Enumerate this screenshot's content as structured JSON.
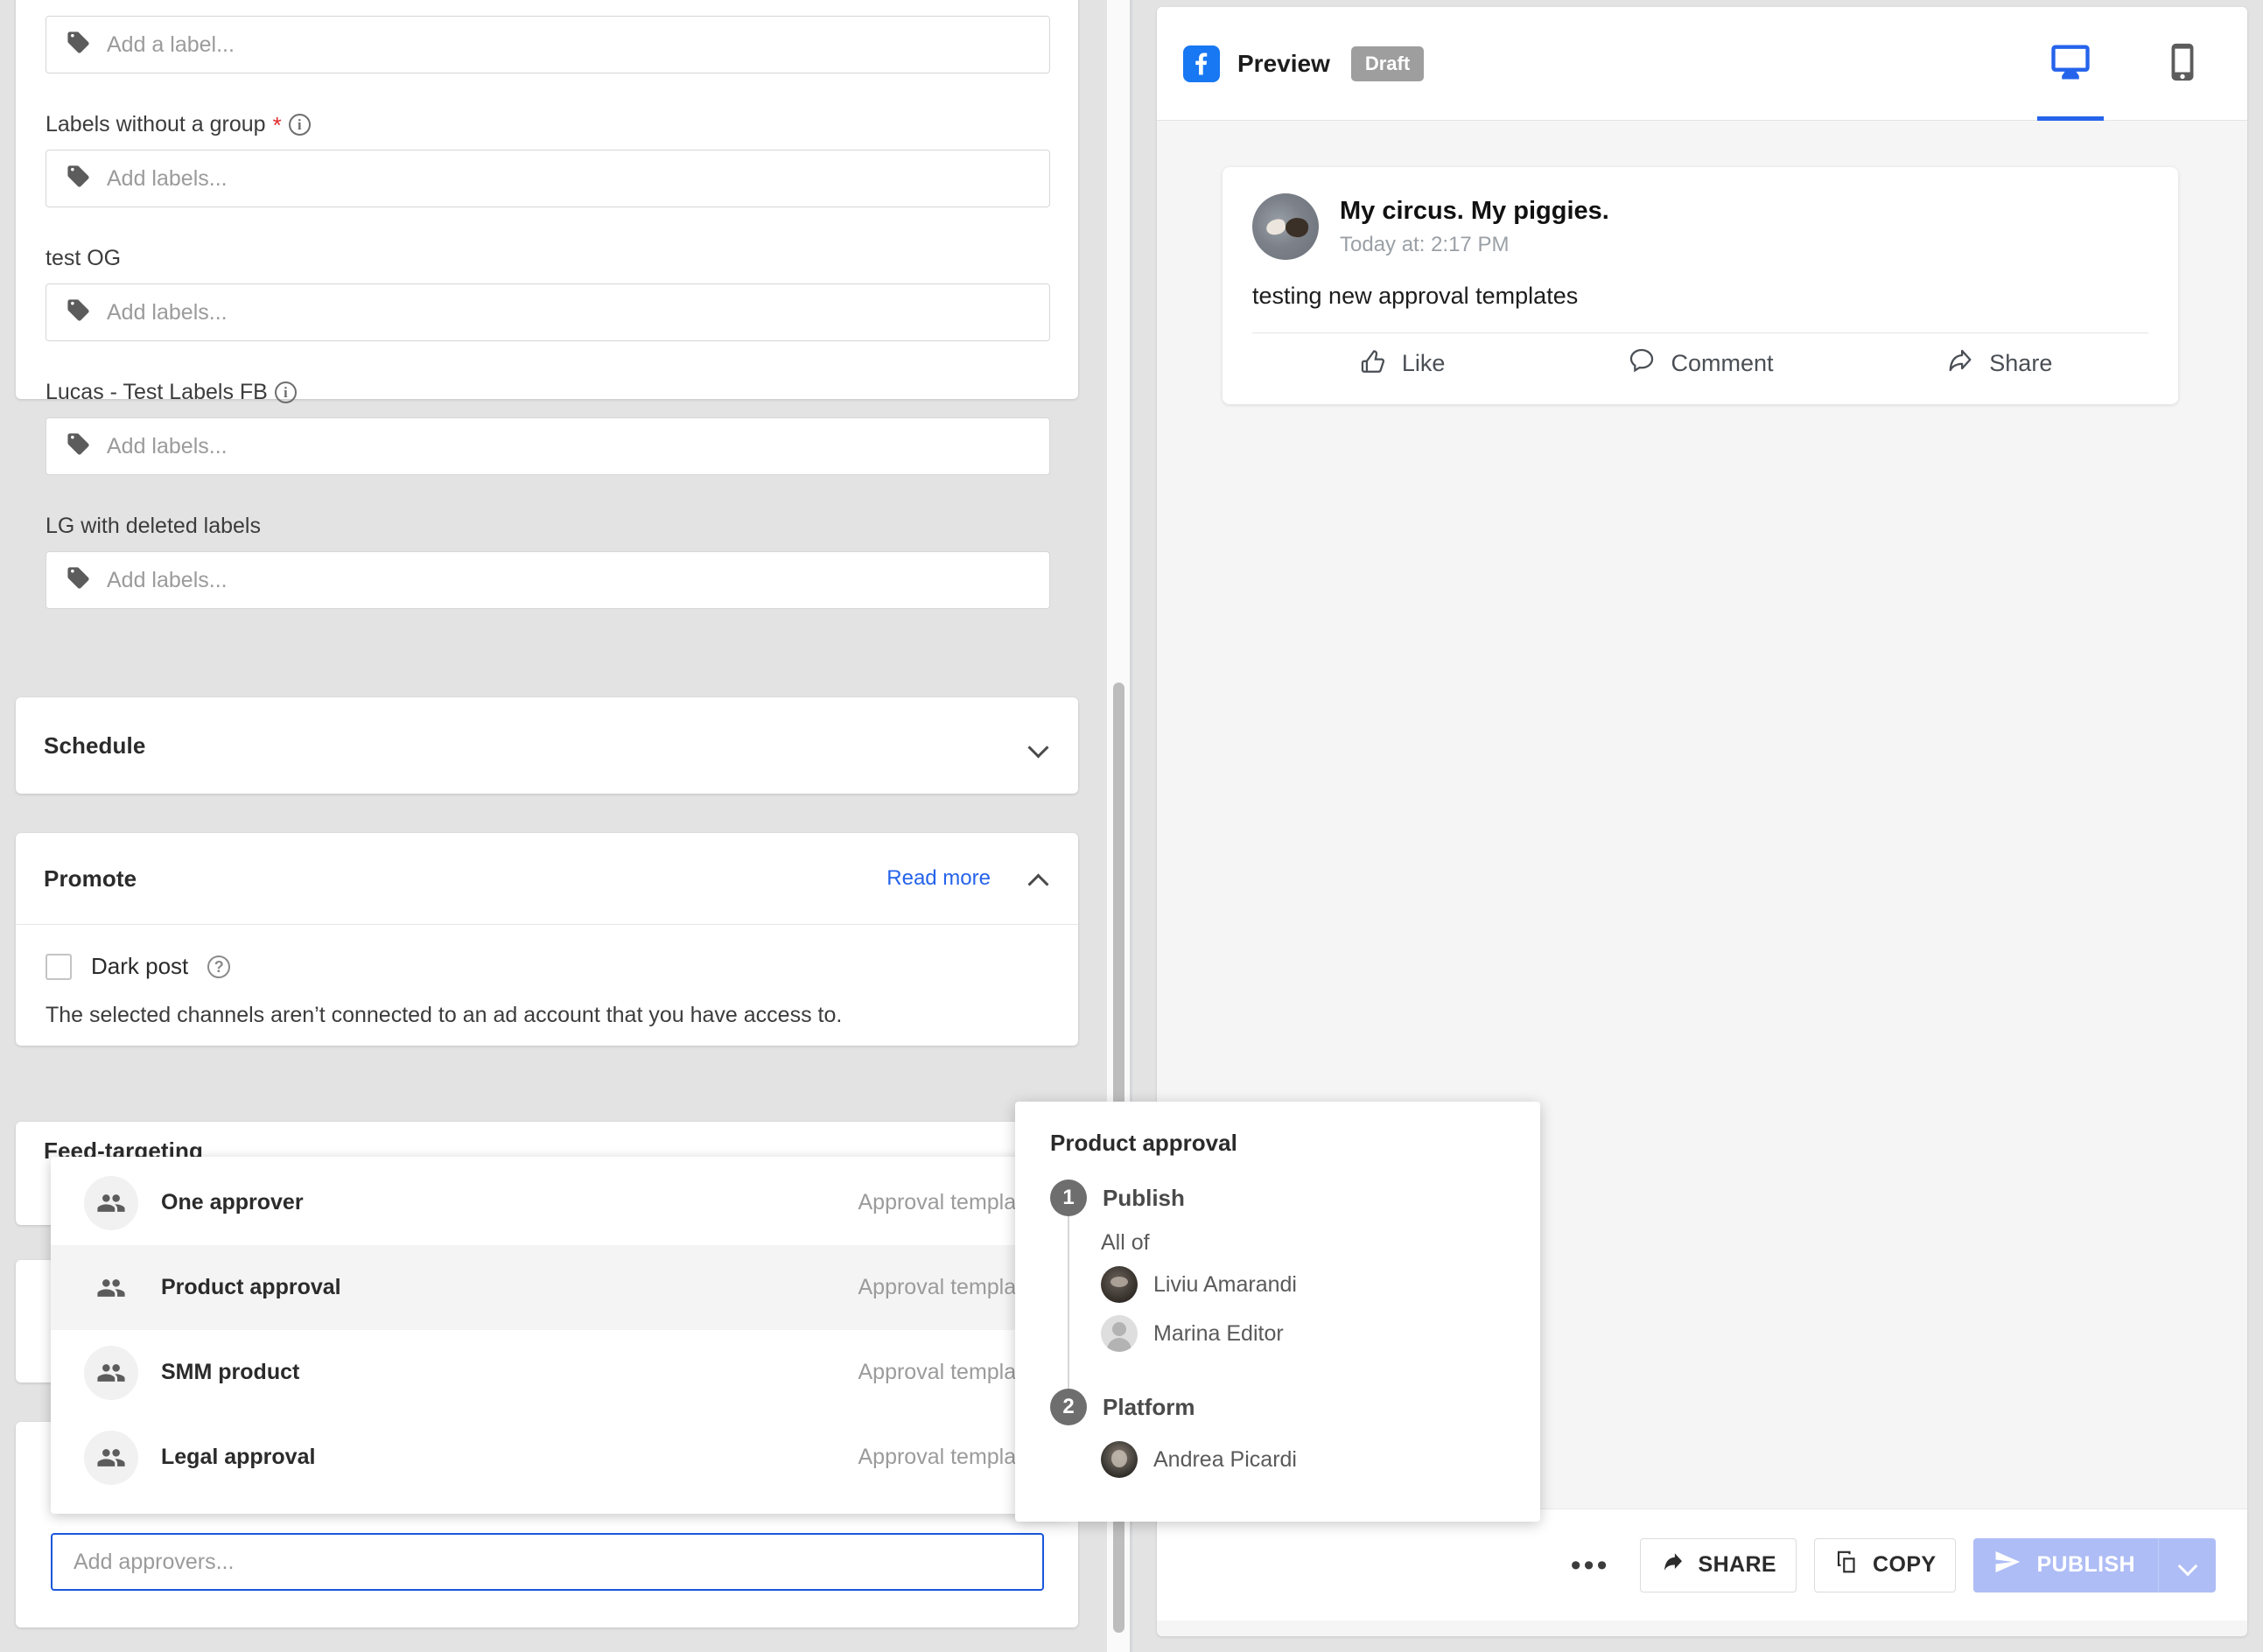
{
  "left_panel": {
    "labels_card": {
      "top_input_placeholder": "Add a label...",
      "groups": [
        {
          "title": "Labels without a group",
          "required": true,
          "has_info": true,
          "placeholder": "Add labels..."
        },
        {
          "title": "test OG",
          "required": false,
          "has_info": false,
          "placeholder": "Add labels..."
        },
        {
          "title": "Lucas - Test Labels FB",
          "required": false,
          "has_info": true,
          "placeholder": "Add labels..."
        },
        {
          "title": "LG with deleted labels",
          "required": false,
          "has_info": false,
          "placeholder": "Add labels..."
        }
      ]
    },
    "schedule": {
      "title": "Schedule"
    },
    "promote": {
      "title": "Promote",
      "read_more": "Read more",
      "dark_post_label": "Dark post",
      "note": "The selected channels aren’t connected to an ad account that you have access to."
    },
    "feed_targeting": {
      "title": "Feed-targeting"
    },
    "approvers_input": {
      "placeholder": "Add approvers..."
    }
  },
  "dropdown": {
    "items": [
      {
        "name": "One approver",
        "type": "Approval template",
        "selected": false
      },
      {
        "name": "Product approval",
        "type": "Approval template",
        "selected": true
      },
      {
        "name": "SMM product",
        "type": "Approval template",
        "selected": false
      },
      {
        "name": "Legal approval",
        "type": "Approval template",
        "selected": false
      }
    ]
  },
  "popover": {
    "title": "Product approval",
    "steps": [
      {
        "number": "1",
        "name": "Publish",
        "condition": "All of",
        "people": [
          {
            "name": "Liviu Amarandi",
            "avatar": "photo"
          },
          {
            "name": "Marina Editor",
            "avatar": "placeholder"
          }
        ]
      },
      {
        "number": "2",
        "name": "Platform",
        "condition": "",
        "people": [
          {
            "name": "Andrea Picardi",
            "avatar": "photo"
          }
        ]
      }
    ]
  },
  "preview": {
    "network_icon": "facebook-icon",
    "label": "Preview",
    "status_badge": "Draft",
    "tabs": [
      {
        "icon": "desktop-icon",
        "active": true
      },
      {
        "icon": "mobile-icon",
        "active": false
      }
    ],
    "post": {
      "author": "My circus. My piggies.",
      "timestamp": "Today at: 2:17 PM",
      "body": "testing new approval templates",
      "actions": [
        {
          "icon": "thumbs-up-icon",
          "label": "Like"
        },
        {
          "icon": "comment-bubble-icon",
          "label": "Comment"
        },
        {
          "icon": "share-arrow-icon",
          "label": "Share"
        }
      ]
    }
  },
  "bottom_bar": {
    "more_label": "•••",
    "share_label": "SHARE",
    "copy_label": "COPY",
    "publish_label": "PUBLISH"
  },
  "colors": {
    "accent_blue": "#2563eb",
    "facebook_blue": "#1877f2",
    "publish_disabled": "#aebdf5",
    "required_red": "#e02b2b",
    "draft_grey": "#9e9e9e"
  }
}
